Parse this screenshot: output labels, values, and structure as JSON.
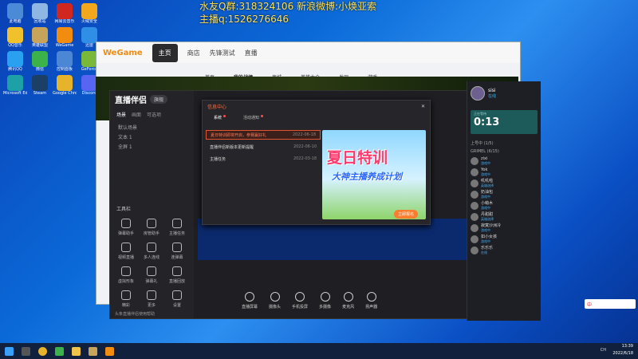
{
  "overlay": {
    "line1": "水友Q群:318324106 新浪微博:小焕亚索",
    "line2": "主播q:1526276646"
  },
  "desktop_icons": [
    {
      "label": "此电脑",
      "color": "#4a8ad6"
    },
    {
      "label": "回收站",
      "color": "#8fb7e3"
    },
    {
      "label": "网易云音乐",
      "color": "#d0271f"
    },
    {
      "label": "火绒安全",
      "color": "#f2a71c"
    },
    {
      "label": "QQ音乐",
      "color": "#f0c12a"
    },
    {
      "label": "英雄联盟",
      "color": "#c8a45a"
    },
    {
      "label": "WeGame",
      "color": "#f28c0f"
    },
    {
      "label": "迅雷",
      "color": "#2f8fe6"
    },
    {
      "label": "腾讯QQ",
      "color": "#2aa1f0"
    },
    {
      "label": "微信",
      "color": "#3cb34a"
    },
    {
      "label": "控制面板",
      "color": "#4b87d4"
    },
    {
      "label": "GeForce",
      "color": "#7ab83a"
    },
    {
      "label": "Microsoft Edge",
      "color": "#1da0a6"
    },
    {
      "label": "Steam",
      "color": "#1c3f66"
    },
    {
      "label": "Google Chrome",
      "color": "#e6b32a"
    },
    {
      "label": "Discord",
      "color": "#5865f2"
    }
  ],
  "wegame": {
    "logo": "WeGame",
    "tabs": [
      "主页",
      "商店",
      "先锋测试",
      "直播"
    ],
    "subtabs": [
      "首页",
      "我的战绩",
      "商城",
      "英雄大全",
      "发现",
      "游戏"
    ]
  },
  "zhibo": {
    "title": "直播伴侣",
    "pill": "旗舰",
    "tabs": [
      "场景",
      "画面",
      "可选项"
    ],
    "scenes": [
      "默认场景",
      "文本 1",
      "全屏 1"
    ],
    "tools_title": "工具栏",
    "tools": [
      "弹幕助手",
      "房管助手",
      "主播任务",
      "视频直播",
      "多人连线",
      "连弹幕",
      "虚拟形象",
      "弹幕礼",
      "直播回放",
      "精彩",
      "更多",
      "设置"
    ],
    "footer": "头条直播伴侣使用帮助",
    "bottom_tools": [
      "直播屏幕",
      "摄像头",
      "手机投屏",
      "多摄像",
      "麦克风",
      "扬声器"
    ]
  },
  "modal": {
    "title": "信息中心",
    "tabs": [
      "系统",
      "活动通知"
    ],
    "messages": [
      {
        "text": "夏日特训即将开启，参赛赢好礼",
        "time": "2022-06-18",
        "highlight": true
      },
      {
        "text": "直播伴侣新版本更新提醒",
        "time": "2022-06-10",
        "highlight": false
      },
      {
        "text": "主播任务",
        "time": "2022-03-18",
        "highlight": false
      }
    ],
    "banner_title": "夏日特训",
    "banner_sub": "大神主播养成计划",
    "banner_btn": "立即报名"
  },
  "right_panel": {
    "user": "sisi",
    "user_sub": "在线",
    "timer_label": "正在等待",
    "timer": "0:13",
    "section1": "上号中 (1/5)",
    "section2": "GRIMEL (6/15)",
    "members": [
      {
        "name": "zixi",
        "status": "游戏中"
      },
      {
        "name": "Yok",
        "status": "游戏中"
      },
      {
        "name": "叽叽啦",
        "status": "英雄选择"
      },
      {
        "name": "奶油包",
        "status": "游戏中"
      },
      {
        "name": "小萌木",
        "status": "游戏中"
      },
      {
        "name": "丹甜甜",
        "status": "英雄选择"
      },
      {
        "name": "寂寞沙洲冷",
        "status": "游戏中"
      },
      {
        "name": "如小女孩",
        "status": "游戏中"
      },
      {
        "name": "乐乐乐",
        "status": "在线"
      }
    ]
  },
  "ime": {
    "label": "中"
  },
  "taskbar": {
    "time": "13:39",
    "date": "2022/6/18",
    "tray": "CH"
  }
}
